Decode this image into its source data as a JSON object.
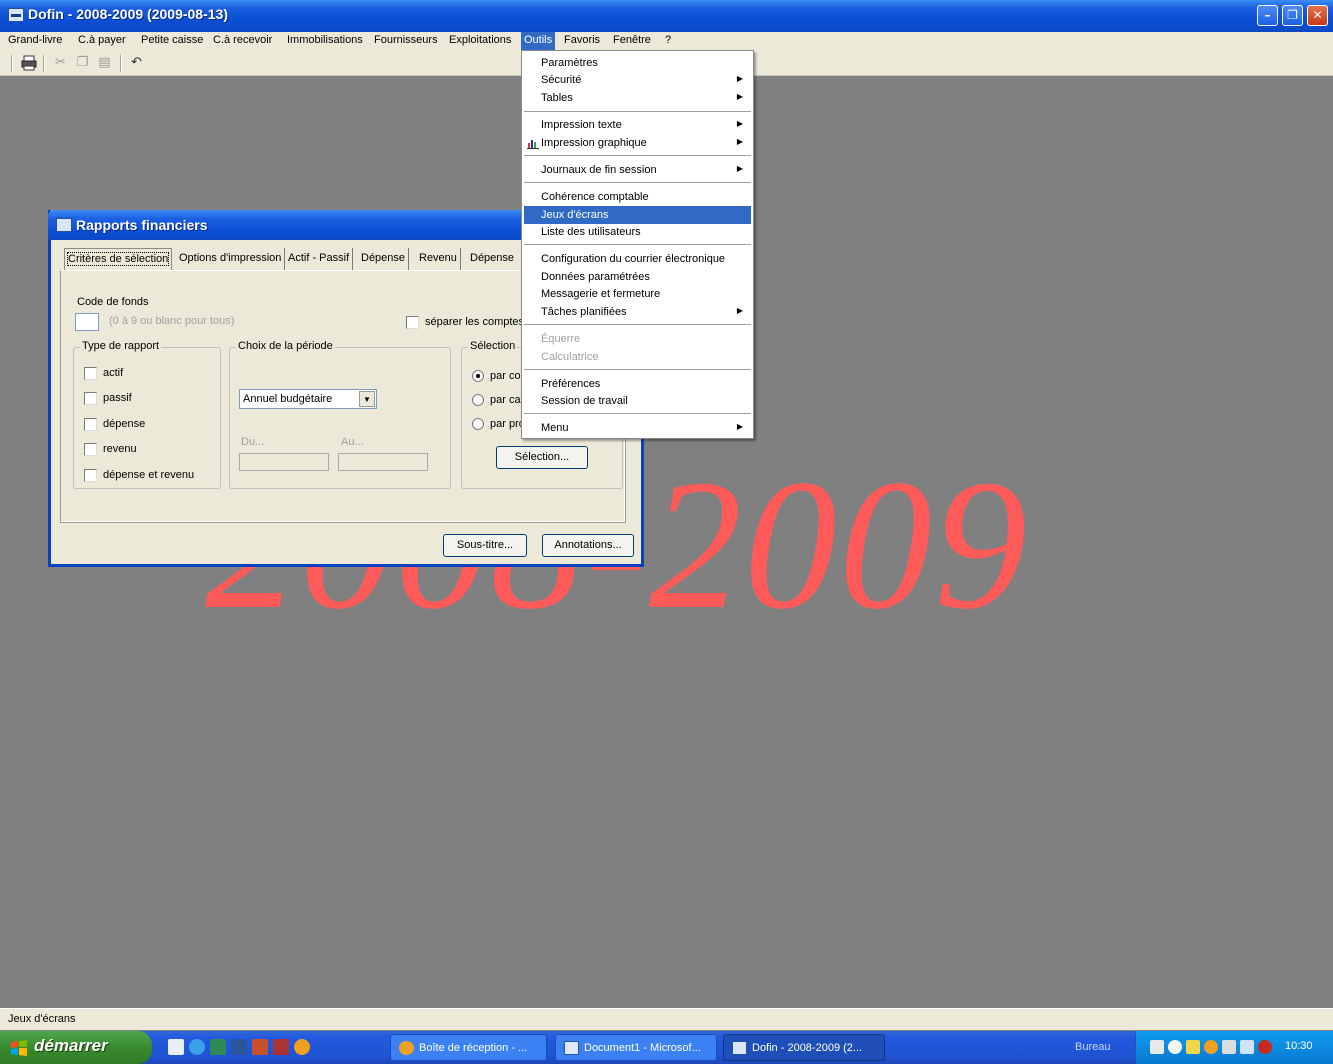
{
  "window": {
    "title": "Dofin - 2008-2009 (2009-08-13)",
    "controls": [
      "minimize",
      "restore",
      "close"
    ]
  },
  "menubar": {
    "items": [
      "Grand-livre",
      "C.à payer",
      "Petite caisse",
      "C.à recevoir",
      "Immobilisations",
      "Fournisseurs",
      "Exploitations",
      "Outils",
      "Favoris",
      "Fenêtre",
      "?"
    ],
    "active": "Outils"
  },
  "toolbar": {
    "icons": [
      "print-icon",
      "cut-icon",
      "copy-icon",
      "paste-icon",
      "undo-icon"
    ]
  },
  "watermark": "2008-2009",
  "dialog": {
    "title": "Rapports financiers",
    "tabs": [
      "Critères de sélection",
      "Options d'impression",
      "Actif - Passif",
      "Dépense",
      "Revenu",
      "Dépense"
    ],
    "selected_tab": "Critères de sélection",
    "code_fonds_label": "Code de fonds",
    "code_fonds_hint": "(0 à 9 ou blanc pour tous)",
    "separer_label": "séparer les comptes",
    "type_rapport": {
      "legend": "Type de rapport",
      "options": [
        "actif",
        "passif",
        "dépense",
        "revenu",
        "dépense et revenu"
      ]
    },
    "periode": {
      "legend": "Choix de la période",
      "selected": "Annuel budgétaire",
      "du_label": "Du...",
      "au_label": "Au..."
    },
    "selection": {
      "legend": "Sélection",
      "options": [
        "par cor",
        "par cat",
        "par pro"
      ],
      "checked": "par cor",
      "button": "Sélection..."
    },
    "buttons": {
      "sous_titre": "Sous-titre...",
      "annotations": "Annotations..."
    }
  },
  "outils_menu": {
    "items": [
      "Paramètres",
      "Sécurité",
      "Tables",
      "Impression texte",
      "Impression graphique",
      "Journaux de fin session",
      "Cohérence comptable",
      "Jeux d'écrans",
      "Liste des utilisateurs",
      "Configuration du courrier électronique",
      "Données paramétrées",
      "Messagerie et fermeture",
      "Tâches planifiées",
      "Équerre",
      "Calculatrice",
      "Préférences",
      "Session de travail",
      "Menu"
    ],
    "highlighted": "Jeux d'écrans",
    "disabled": [
      "Équerre",
      "Calculatrice"
    ]
  },
  "statusbar": {
    "text": "Jeux d'écrans"
  },
  "taskbar": {
    "start": "démarrer",
    "tasks": [
      "Boîte de réception - ...",
      "Document1 - Microsof...",
      "Dofin - 2008-2009 (2..."
    ],
    "active_task": "Dofin - 2008-2009 (2...",
    "bureau": "Bureau",
    "clock": "10:30"
  }
}
